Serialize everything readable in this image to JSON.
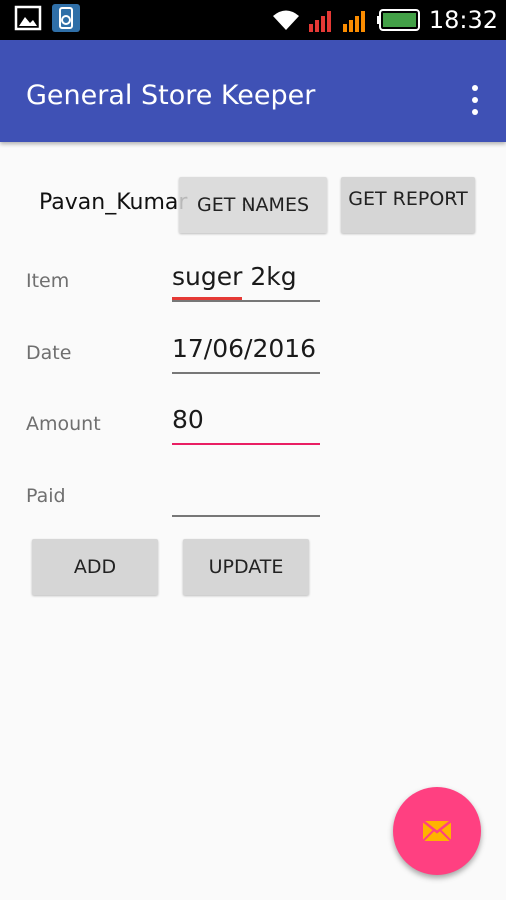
{
  "status_bar": {
    "time": "18:32",
    "icons": [
      "image-icon",
      "app-notification-icon",
      "wifi-icon",
      "signal-icon",
      "signal-icon",
      "battery-icon"
    ]
  },
  "app_bar": {
    "title": "General Store Keeper",
    "overflow_icon": "more-vert-icon"
  },
  "customer_spinner": {
    "value": "Pavan_Kumar"
  },
  "buttons": {
    "get_names": "GET NAMES",
    "get_report": "GET REPORT",
    "add": "ADD",
    "update": "UPDATE"
  },
  "form": {
    "item": {
      "label": "Item",
      "value": "suger 2kg"
    },
    "date": {
      "label": "Date",
      "value": "17/06/2016"
    },
    "amount": {
      "label": "Amount",
      "value": "80"
    },
    "paid": {
      "label": "Paid",
      "value": ""
    }
  },
  "fab": {
    "icon": "mail-icon"
  },
  "colors": {
    "primary": "#3f51b5",
    "accent": "#ff4081",
    "focus_underline": "#e91e63"
  }
}
